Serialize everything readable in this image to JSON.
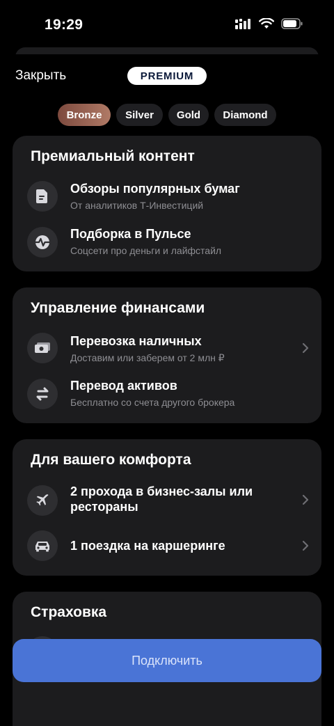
{
  "status_bar": {
    "time": "19:29"
  },
  "header": {
    "close_label": "Закрыть",
    "badge": "PREMIUM"
  },
  "tiers": [
    "Bronze",
    "Silver",
    "Gold",
    "Diamond"
  ],
  "active_tier": "Bronze",
  "sections": {
    "content": {
      "title": "Премиальный контент",
      "items": [
        {
          "title": "Обзоры популярных бумаг",
          "subtitle": "От аналитиков Т-Инвестиций",
          "icon": "document-icon"
        },
        {
          "title": "Подборка в Пульсе",
          "subtitle": "Соцсети про деньги и лайфстайл",
          "icon": "pulse-icon"
        }
      ]
    },
    "finance": {
      "title": "Управление финансами",
      "items": [
        {
          "title": "Перевозка наличных",
          "subtitle": "Доставим или заберем от 2 млн ₽",
          "icon": "cash-icon"
        },
        {
          "title": "Перевод активов",
          "subtitle": "Бесплатно со счета другого брокера",
          "icon": "transfer-icon"
        }
      ]
    },
    "comfort": {
      "title": "Для вашего комфорта",
      "items": [
        {
          "title": "2 прохода в бизнес-залы или рестораны",
          "icon": "airplane-icon"
        },
        {
          "title": "1 поездка на каршеринге",
          "icon": "car-icon"
        }
      ]
    },
    "insurance": {
      "title": "Страховка"
    }
  },
  "footer": {
    "connect_label": "Подключить"
  },
  "colors": {
    "accent_button": "#4a74d6",
    "card_bg": "#1c1c1e",
    "bronze_gradient": [
      "#7d4a3e",
      "#b07a66"
    ]
  }
}
